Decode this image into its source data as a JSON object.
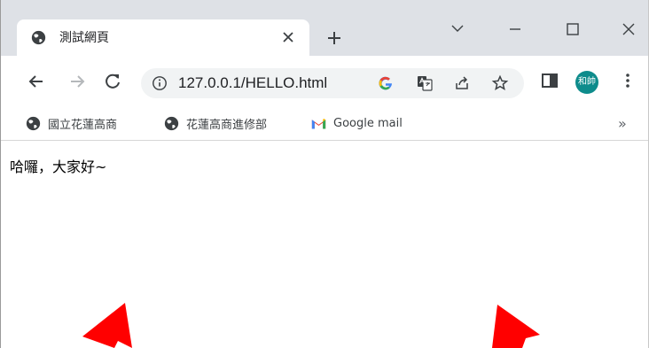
{
  "tab": {
    "title": "測試網頁",
    "close_icon": "close-icon",
    "favicon": "globe-icon"
  },
  "new_tab_icon": "plus-icon",
  "window_controls": [
    "chevron-down-icon",
    "minimize-icon",
    "maximize-icon",
    "close-icon"
  ],
  "toolbar": {
    "url": "127.0.0.1/HELLO.html",
    "icons": [
      "back-icon",
      "forward-icon",
      "reload-icon",
      "info-icon",
      "google-icon",
      "translate-icon",
      "share-icon",
      "star-icon",
      "sidepanel-icon",
      "menu-icon"
    ],
    "avatar_label": "和帥"
  },
  "bookmarks": [
    {
      "label": "國立花蓮高商",
      "icon": "globe-icon"
    },
    {
      "label": "花蓮高商進修部",
      "icon": "globe-icon"
    },
    {
      "label": "Google mail",
      "icon": "gmail-icon"
    }
  ],
  "bookmarks_more": "»",
  "content": {
    "greeting": "哈囉，大家好~"
  },
  "colors": {
    "tabstrip": "#dee1e6",
    "omnibox": "#f1f3f4",
    "avatar": "#0e8c8c",
    "arrow": "#ff0000"
  }
}
